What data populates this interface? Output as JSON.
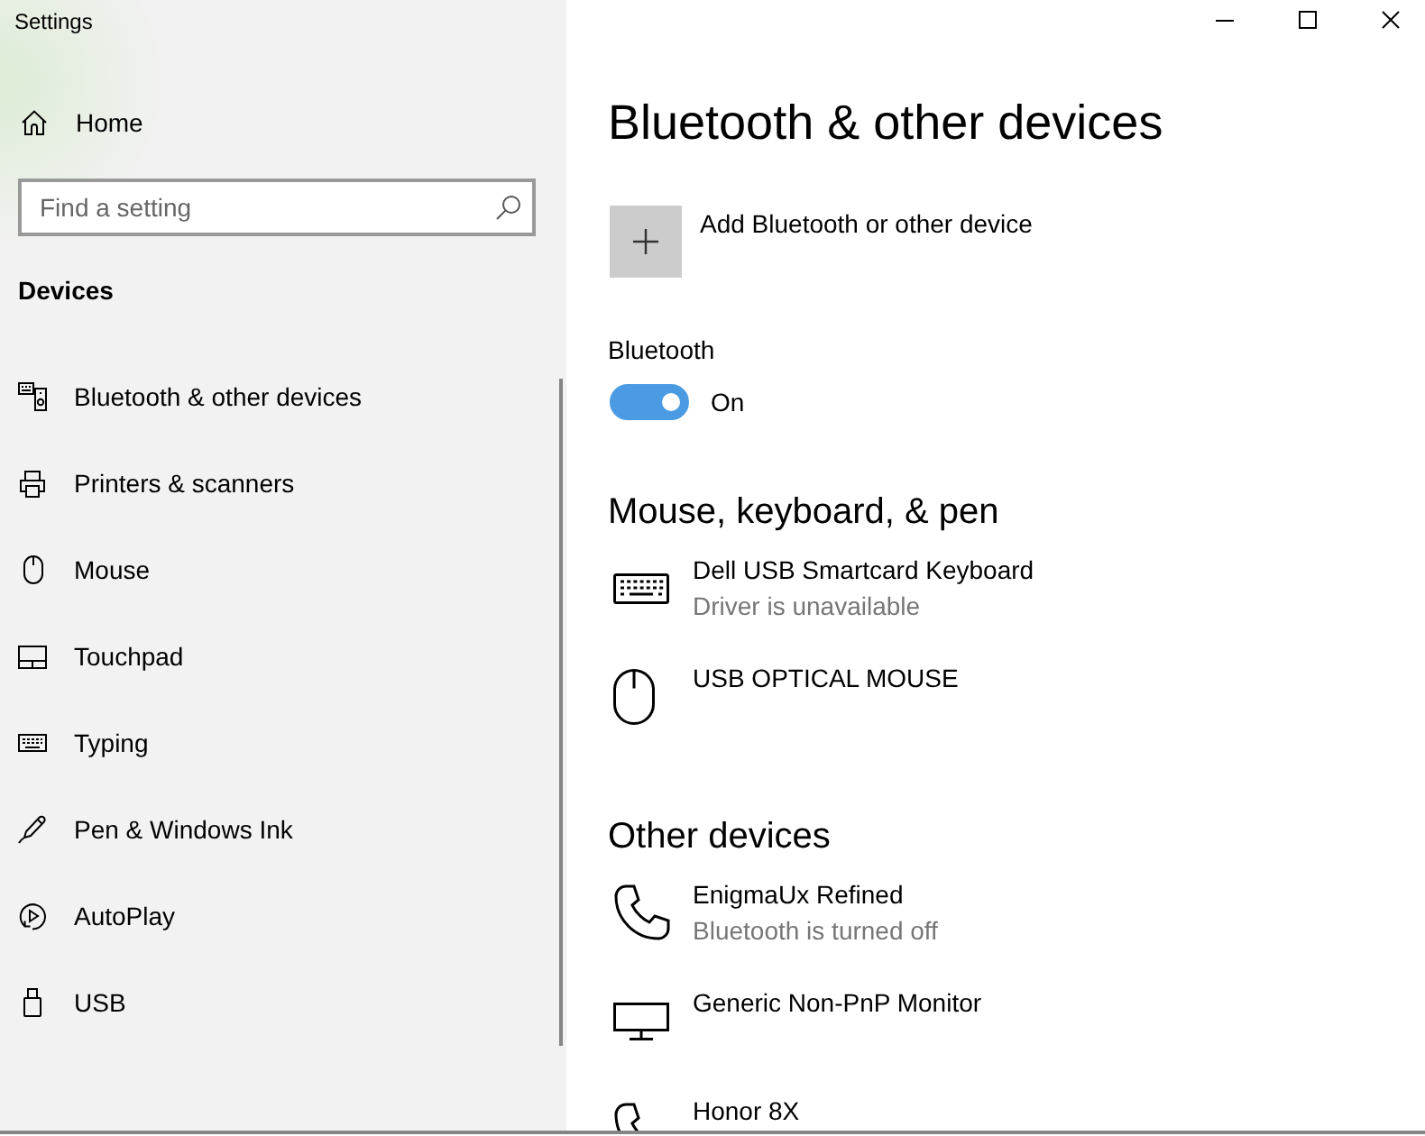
{
  "window": {
    "title": "Settings"
  },
  "sidebar": {
    "home": {
      "label": "Home"
    },
    "search": {
      "placeholder": "Find a setting"
    },
    "section_title": "Devices",
    "items": [
      {
        "label": "Bluetooth & other devices"
      },
      {
        "label": "Printers & scanners"
      },
      {
        "label": "Mouse"
      },
      {
        "label": "Touchpad"
      },
      {
        "label": "Typing"
      },
      {
        "label": "Pen & Windows Ink"
      },
      {
        "label": "AutoPlay"
      },
      {
        "label": "USB"
      }
    ]
  },
  "page": {
    "title": "Bluetooth & other devices",
    "add_device": {
      "label": "Add Bluetooth or other device"
    },
    "bluetooth": {
      "label": "Bluetooth",
      "on": true,
      "state_text": "On"
    },
    "sections": [
      {
        "title": "Mouse, keyboard, & pen",
        "devices": [
          {
            "name": "Dell USB Smartcard Keyboard",
            "status": "Driver is unavailable"
          },
          {
            "name": "USB OPTICAL MOUSE"
          }
        ]
      },
      {
        "title": "Other devices",
        "devices": [
          {
            "name": "EnigmaUx Refined",
            "status": "Bluetooth is turned off"
          },
          {
            "name": "Generic Non-PnP Monitor"
          },
          {
            "name": "Honor 8X"
          }
        ]
      }
    ]
  }
}
